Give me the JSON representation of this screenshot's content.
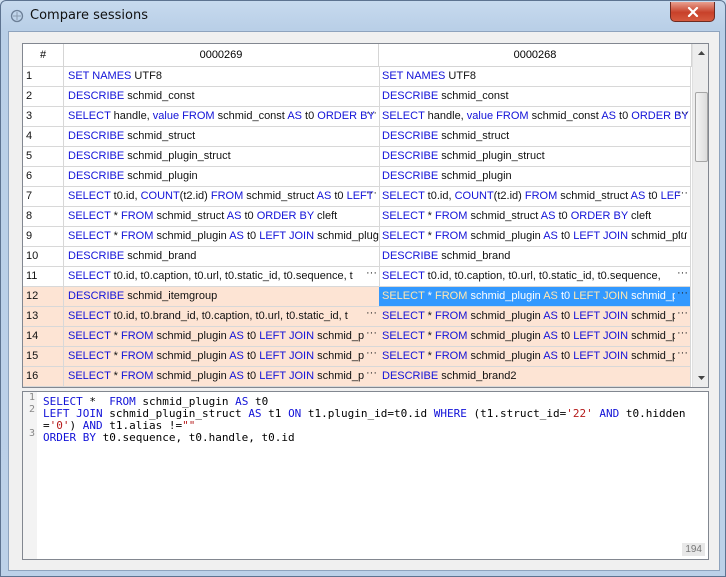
{
  "window": {
    "title": "Compare sessions",
    "close_icon": "close-icon",
    "app_icon": "app-icon"
  },
  "grid": {
    "columns": [
      "#",
      "0000269",
      "0000268"
    ],
    "rows": [
      {
        "num": "1",
        "left": [
          [
            "kw",
            "SET NAMES"
          ],
          [
            "t",
            " UTF8"
          ]
        ],
        "right": [
          [
            "kw",
            "SET NAMES"
          ],
          [
            "t",
            " UTF8"
          ]
        ],
        "diff": false,
        "left_ellipsis": false,
        "right_ellipsis": false
      },
      {
        "num": "2",
        "left": [
          [
            "kw",
            "DESCRIBE"
          ],
          [
            "t",
            " schmid_const"
          ]
        ],
        "right": [
          [
            "kw",
            "DESCRIBE"
          ],
          [
            "t",
            " schmid_const"
          ]
        ],
        "diff": false,
        "left_ellipsis": false,
        "right_ellipsis": false
      },
      {
        "num": "3",
        "left": [
          [
            "kw",
            "SELECT"
          ],
          [
            "t",
            " handle, "
          ],
          [
            "kw",
            "value"
          ],
          [
            "t",
            " "
          ],
          [
            "kw",
            "FROM"
          ],
          [
            "t",
            " schmid_const "
          ],
          [
            "kw",
            "AS"
          ],
          [
            "t",
            " t0 "
          ],
          [
            "kw",
            "ORDER BY"
          ]
        ],
        "right": [
          [
            "kw",
            "SELECT"
          ],
          [
            "t",
            " handle, "
          ],
          [
            "kw",
            "value"
          ],
          [
            "t",
            " "
          ],
          [
            "kw",
            "FROM"
          ],
          [
            "t",
            " schmid_const "
          ],
          [
            "kw",
            "AS"
          ],
          [
            "t",
            " t0 "
          ],
          [
            "kw",
            "ORDER BY"
          ]
        ],
        "diff": false,
        "left_ellipsis": true,
        "right_ellipsis": true
      },
      {
        "num": "4",
        "left": [
          [
            "kw",
            "DESCRIBE"
          ],
          [
            "t",
            " schmid_struct"
          ]
        ],
        "right": [
          [
            "kw",
            "DESCRIBE"
          ],
          [
            "t",
            " schmid_struct"
          ]
        ],
        "diff": false,
        "left_ellipsis": false,
        "right_ellipsis": false
      },
      {
        "num": "5",
        "left": [
          [
            "kw",
            "DESCRIBE"
          ],
          [
            "t",
            " schmid_plugin_struct"
          ]
        ],
        "right": [
          [
            "kw",
            "DESCRIBE"
          ],
          [
            "t",
            " schmid_plugin_struct"
          ]
        ],
        "diff": false,
        "left_ellipsis": false,
        "right_ellipsis": false
      },
      {
        "num": "6",
        "left": [
          [
            "kw",
            "DESCRIBE"
          ],
          [
            "t",
            " schmid_plugin"
          ]
        ],
        "right": [
          [
            "kw",
            "DESCRIBE"
          ],
          [
            "t",
            " schmid_plugin"
          ]
        ],
        "diff": false,
        "left_ellipsis": false,
        "right_ellipsis": false
      },
      {
        "num": "7",
        "left": [
          [
            "kw",
            "SELECT"
          ],
          [
            "t",
            " t0.id, "
          ],
          [
            "kw",
            "COUNT"
          ],
          [
            "t",
            "(t2.id) "
          ],
          [
            "kw",
            "FROM"
          ],
          [
            "t",
            " schmid_struct "
          ],
          [
            "kw",
            "AS"
          ],
          [
            "t",
            " t0 "
          ],
          [
            "kw",
            "LEFT"
          ]
        ],
        "right": [
          [
            "kw",
            "SELECT"
          ],
          [
            "t",
            " t0.id, "
          ],
          [
            "kw",
            "COUNT"
          ],
          [
            "t",
            "(t2.id) "
          ],
          [
            "kw",
            "FROM"
          ],
          [
            "t",
            " schmid_struct "
          ],
          [
            "kw",
            "AS"
          ],
          [
            "t",
            " t0 "
          ],
          [
            "kw",
            "LEF"
          ]
        ],
        "diff": false,
        "left_ellipsis": true,
        "right_ellipsis": true
      },
      {
        "num": "8",
        "left": [
          [
            "kw",
            "SELECT"
          ],
          [
            "t",
            " * "
          ],
          [
            "kw",
            "FROM"
          ],
          [
            "t",
            " schmid_struct "
          ],
          [
            "kw",
            "AS"
          ],
          [
            "t",
            " t0 "
          ],
          [
            "kw",
            "ORDER BY"
          ],
          [
            "t",
            " cleft"
          ]
        ],
        "right": [
          [
            "kw",
            "SELECT"
          ],
          [
            "t",
            " * "
          ],
          [
            "kw",
            "FROM"
          ],
          [
            "t",
            " schmid_struct "
          ],
          [
            "kw",
            "AS"
          ],
          [
            "t",
            " t0 "
          ],
          [
            "kw",
            "ORDER BY"
          ],
          [
            "t",
            " cleft"
          ]
        ],
        "diff": false,
        "left_ellipsis": false,
        "right_ellipsis": false
      },
      {
        "num": "9",
        "left": [
          [
            "kw",
            "SELECT"
          ],
          [
            "t",
            " * "
          ],
          [
            "kw",
            "FROM"
          ],
          [
            "t",
            " schmid_plugin "
          ],
          [
            "kw",
            "AS"
          ],
          [
            "t",
            " t0 "
          ],
          [
            "kw",
            "LEFT JOIN"
          ],
          [
            "t",
            " schmid_plug"
          ]
        ],
        "right": [
          [
            "kw",
            "SELECT"
          ],
          [
            "t",
            " * "
          ],
          [
            "kw",
            "FROM"
          ],
          [
            "t",
            " schmid_plugin "
          ],
          [
            "kw",
            "AS"
          ],
          [
            "t",
            " t0 "
          ],
          [
            "kw",
            "LEFT JOIN"
          ],
          [
            "t",
            " schmid_plu"
          ]
        ],
        "diff": false,
        "left_ellipsis": true,
        "right_ellipsis": true
      },
      {
        "num": "10",
        "left": [
          [
            "kw",
            "DESCRIBE"
          ],
          [
            "t",
            " schmid_brand"
          ]
        ],
        "right": [
          [
            "kw",
            "DESCRIBE"
          ],
          [
            "t",
            " schmid_brand"
          ]
        ],
        "diff": false,
        "left_ellipsis": false,
        "right_ellipsis": false
      },
      {
        "num": "11",
        "left": [
          [
            "kw",
            "SELECT"
          ],
          [
            "t",
            " t0.id, t0.caption, t0.url, t0.static_id, t0.sequence, t"
          ]
        ],
        "right": [
          [
            "kw",
            "SELECT"
          ],
          [
            "t",
            " t0.id, t0.caption, t0.url, t0.static_id, t0.sequence,"
          ]
        ],
        "diff": false,
        "left_ellipsis": true,
        "right_ellipsis": true
      },
      {
        "num": "12",
        "left": [
          [
            "kw",
            "DESCRIBE"
          ],
          [
            "t",
            " schmid_itemgroup"
          ]
        ],
        "right": [
          [
            "kw",
            "SELECT"
          ],
          [
            "t",
            " * "
          ],
          [
            "kw",
            "FROM"
          ],
          [
            "t",
            " schmid_plugin "
          ],
          [
            "kw",
            "AS"
          ],
          [
            "t",
            " t0 "
          ],
          [
            "kw",
            "LEFT JOIN"
          ],
          [
            "t",
            " schmid_plu"
          ]
        ],
        "diff": true,
        "left_ellipsis": false,
        "right_ellipsis": true,
        "right_selected": true
      },
      {
        "num": "13",
        "left": [
          [
            "kw",
            "SELECT"
          ],
          [
            "t",
            " t0.id, t0.brand_id, t0.caption, t0.url, t0.static_id, t"
          ]
        ],
        "right": [
          [
            "kw",
            "SELECT"
          ],
          [
            "t",
            " * "
          ],
          [
            "kw",
            "FROM"
          ],
          [
            "t",
            " schmid_plugin "
          ],
          [
            "kw",
            "AS"
          ],
          [
            "t",
            " t0 "
          ],
          [
            "kw",
            "LEFT JOIN"
          ],
          [
            "t",
            " schmid_plu"
          ]
        ],
        "diff": true,
        "left_ellipsis": true,
        "right_ellipsis": true
      },
      {
        "num": "14",
        "left": [
          [
            "kw",
            "SELECT"
          ],
          [
            "t",
            " * "
          ],
          [
            "kw",
            "FROM"
          ],
          [
            "t",
            " schmid_plugin "
          ],
          [
            "kw",
            "AS"
          ],
          [
            "t",
            " t0 "
          ],
          [
            "kw",
            "LEFT JOIN"
          ],
          [
            "t",
            " schmid_plug"
          ]
        ],
        "right": [
          [
            "kw",
            "SELECT"
          ],
          [
            "t",
            " * "
          ],
          [
            "kw",
            "FROM"
          ],
          [
            "t",
            " schmid_plugin "
          ],
          [
            "kw",
            "AS"
          ],
          [
            "t",
            " t0 "
          ],
          [
            "kw",
            "LEFT JOIN"
          ],
          [
            "t",
            " schmid_plu"
          ]
        ],
        "diff": true,
        "left_ellipsis": true,
        "right_ellipsis": true
      },
      {
        "num": "15",
        "left": [
          [
            "kw",
            "SELECT"
          ],
          [
            "t",
            " * "
          ],
          [
            "kw",
            "FROM"
          ],
          [
            "t",
            " schmid_plugin "
          ],
          [
            "kw",
            "AS"
          ],
          [
            "t",
            " t0 "
          ],
          [
            "kw",
            "LEFT JOIN"
          ],
          [
            "t",
            " schmid_plug"
          ]
        ],
        "right": [
          [
            "kw",
            "SELECT"
          ],
          [
            "t",
            " * "
          ],
          [
            "kw",
            "FROM"
          ],
          [
            "t",
            " schmid_plugin "
          ],
          [
            "kw",
            "AS"
          ],
          [
            "t",
            " t0 "
          ],
          [
            "kw",
            "LEFT JOIN"
          ],
          [
            "t",
            " schmid_plu"
          ]
        ],
        "diff": true,
        "left_ellipsis": true,
        "right_ellipsis": true
      },
      {
        "num": "16",
        "left": [
          [
            "kw",
            "SELECT"
          ],
          [
            "t",
            " * "
          ],
          [
            "kw",
            "FROM"
          ],
          [
            "t",
            " schmid_plugin "
          ],
          [
            "kw",
            "AS"
          ],
          [
            "t",
            " t0 "
          ],
          [
            "kw",
            "LEFT JOIN"
          ],
          [
            "t",
            " schmid_plug"
          ]
        ],
        "right": [
          [
            "kw",
            "DESCRIBE"
          ],
          [
            "t",
            " schmid_brand2"
          ]
        ],
        "diff": true,
        "left_ellipsis": true,
        "right_ellipsis": false
      }
    ],
    "ellipsis": "···"
  },
  "editor": {
    "line_numbers": [
      "1",
      "2",
      "",
      "3"
    ],
    "lines": [
      [
        [
          "kw",
          "SELECT"
        ],
        [
          "t",
          " *  "
        ],
        [
          "kw",
          "FROM"
        ],
        [
          "t",
          " schmid_plugin "
        ],
        [
          "kw",
          "AS"
        ],
        [
          "t",
          " t0"
        ]
      ],
      [
        [
          "kw",
          "LEFT JOIN"
        ],
        [
          "t",
          " schmid_plugin_struct "
        ],
        [
          "kw",
          "AS"
        ],
        [
          "t",
          " t1 "
        ],
        [
          "kw",
          "ON"
        ],
        [
          "t",
          " t1.plugin_id=t0.id "
        ],
        [
          "kw",
          "WHERE"
        ],
        [
          "t",
          " (t1.struct_id="
        ],
        [
          "str",
          "'22'"
        ],
        [
          "t",
          " "
        ],
        [
          "kw",
          "AND"
        ],
        [
          "t",
          " t0.hidden="
        ],
        [
          "str",
          "'0'"
        ],
        [
          "t",
          ") "
        ],
        [
          "kw",
          "AND"
        ],
        [
          "t",
          " t1.alias !="
        ],
        [
          "str",
          "\"\""
        ]
      ],
      [
        [
          "kw",
          "ORDER BY"
        ],
        [
          "t",
          " t0.sequence, t0.handle, t0.id"
        ]
      ]
    ],
    "counter": "194"
  },
  "colors": {
    "diff_row": "#fde4d4",
    "selection": "#3399ff",
    "keyword": "#1212d8",
    "string": "#b51a1a"
  }
}
